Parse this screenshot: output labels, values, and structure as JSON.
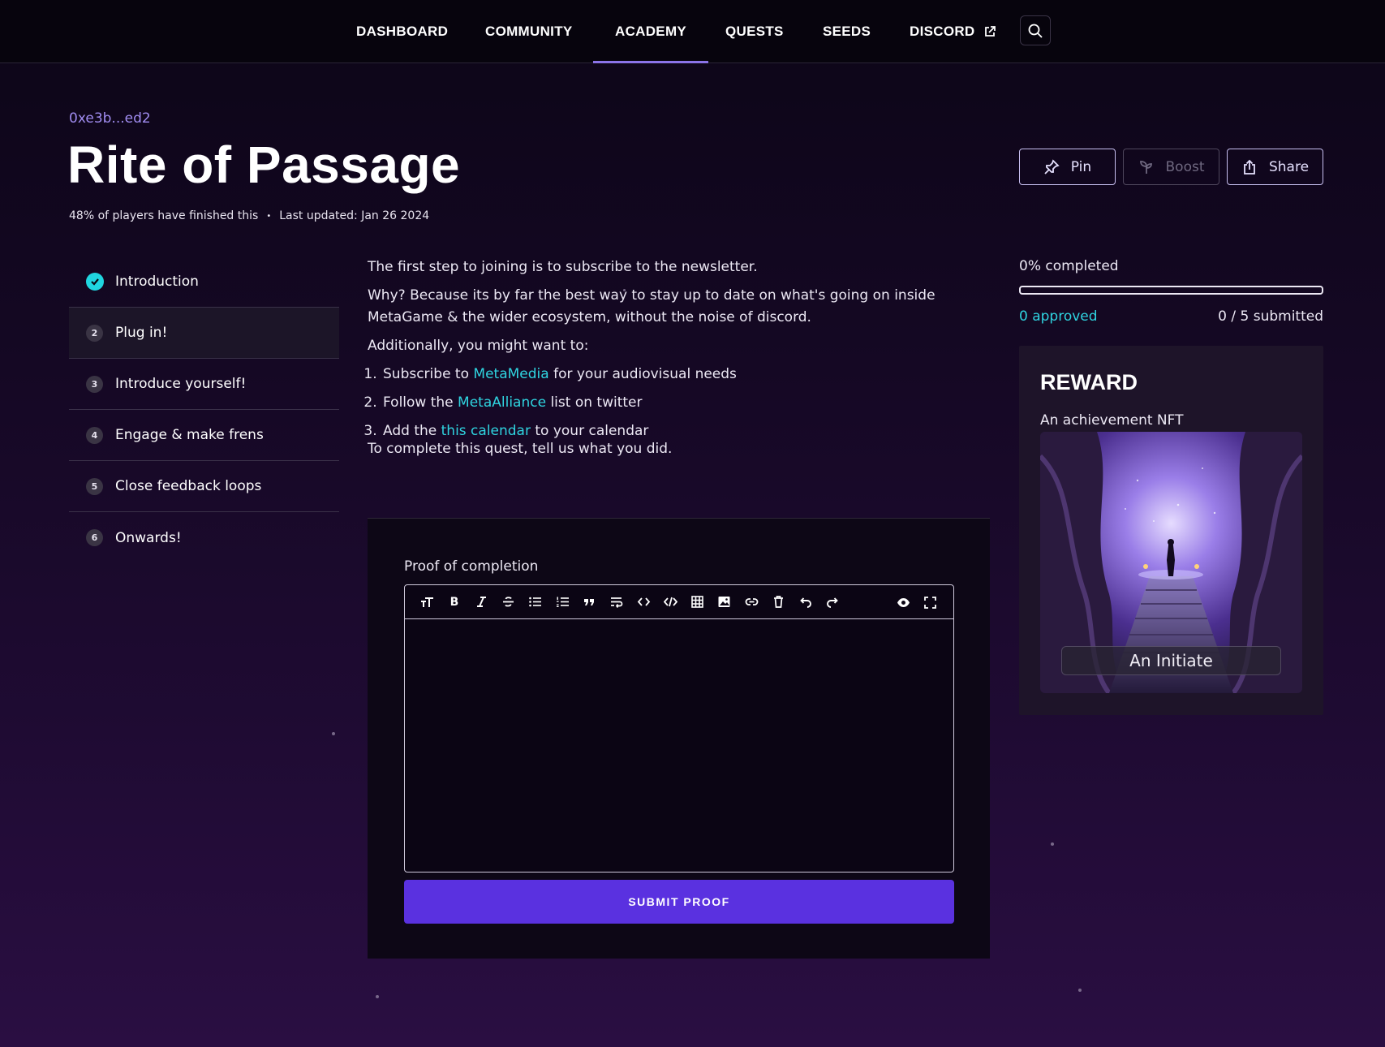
{
  "nav": {
    "items": [
      "DASHBOARD",
      "COMMUNITY",
      "ACADEMY",
      "QUESTS",
      "SEEDS",
      "DISCORD"
    ],
    "active": "ACADEMY"
  },
  "quest": {
    "author": "0xe3b...ed2",
    "title": "Rite of Passage",
    "finished_stat": "48% of players have finished this",
    "updated": "Last updated: Jan 26 2024"
  },
  "actions": {
    "pin": "Pin",
    "boost": "Boost",
    "share": "Share"
  },
  "steps": [
    {
      "num": "1",
      "label": "Introduction",
      "status": "done"
    },
    {
      "num": "2",
      "label": "Plug in!",
      "status": "active"
    },
    {
      "num": "3",
      "label": "Introduce yourself!",
      "status": "todo"
    },
    {
      "num": "4",
      "label": "Engage & make frens",
      "status": "todo"
    },
    {
      "num": "5",
      "label": "Close feedback loops",
      "status": "todo"
    },
    {
      "num": "6",
      "label": "Onwards!",
      "status": "todo"
    }
  ],
  "content": {
    "p1": "The first step to joining is to subscribe to the newsletter.",
    "p2": "Why? Because its by far the best way to stay up to date on what's going on inside MetaGame & the wider ecosystem, without the noise of discord.",
    "p3": "Additionally, you might want to:",
    "list": [
      {
        "before": "Subscribe to ",
        "link": "MetaMedia",
        "after": " for your audiovisual needs"
      },
      {
        "before": "Follow the ",
        "link": "MetaAlliance",
        "after": " list on twitter"
      },
      {
        "before": "Add the ",
        "link": "this calendar",
        "after": " to your calendar"
      }
    ],
    "p4": "To complete this quest, tell us what you did."
  },
  "proof": {
    "label": "Proof of completion",
    "value": "",
    "submit": "SUBMIT PROOF"
  },
  "progress": {
    "completed_text": "0% completed",
    "completed_fraction": 0,
    "approved": "0 approved",
    "submitted": "0 / 5 submitted"
  },
  "reward": {
    "title": "REWARD",
    "description": "An achievement NFT",
    "nft_label": "An Initiate"
  },
  "colors": {
    "accent": "#2fd4e0",
    "primary": "#5a31e0",
    "nav_active": "#8b73e8"
  }
}
